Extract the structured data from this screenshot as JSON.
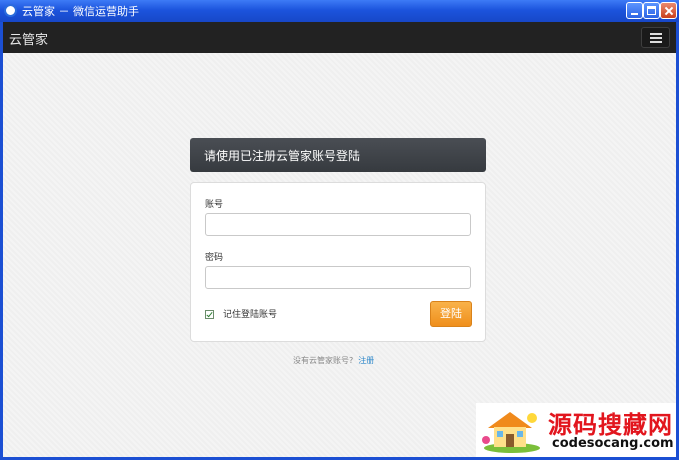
{
  "window": {
    "title": "云管家  －  微信运营助手"
  },
  "appbar": {
    "brand": "云管家",
    "menu_icon": "hamburger-menu-icon"
  },
  "login": {
    "header": "请使用已注册云管家账号登陆",
    "account_label": "账号",
    "account_value": "",
    "password_label": "密码",
    "password_value": "",
    "remember_label": "记住登陆账号",
    "remember_checked": true,
    "submit_label": "登陆"
  },
  "register": {
    "prompt": "没有云管家账号?",
    "link": "注册"
  },
  "watermark": {
    "text": "源码搜藏网",
    "url": "codesocang.com"
  },
  "colors": {
    "titlebar": "#1c54dd",
    "appbar": "#222222",
    "panel_header": "#3e4247",
    "accent": "#ef8f1c",
    "link": "#2b86c9"
  }
}
